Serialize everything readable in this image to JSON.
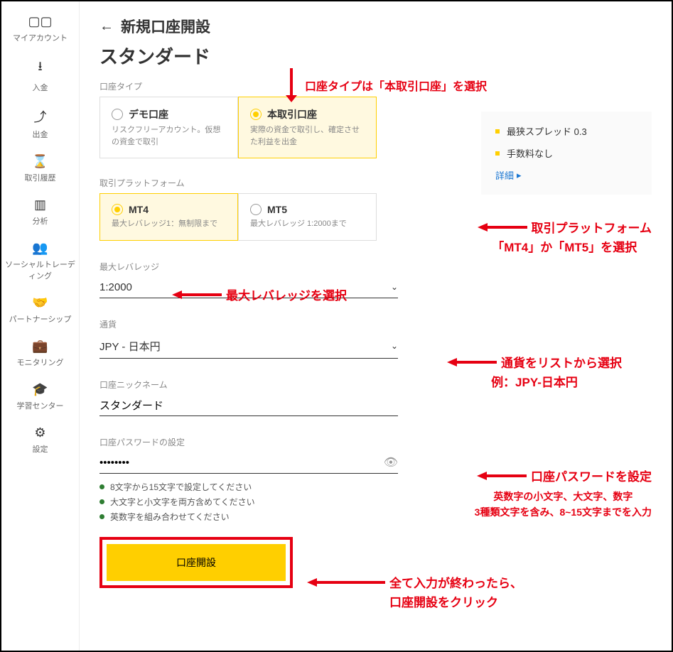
{
  "sidebar": {
    "items": [
      {
        "label": "マイアカウント"
      },
      {
        "label": "入金"
      },
      {
        "label": "出金"
      },
      {
        "label": "取引履歴"
      },
      {
        "label": "分析"
      },
      {
        "label": "ソーシャルトレーディング"
      },
      {
        "label": "パートナーシップ"
      },
      {
        "label": "モニタリング"
      },
      {
        "label": "学習センター"
      },
      {
        "label": "設定"
      }
    ]
  },
  "header": {
    "back_title": "新規口座開設",
    "subtitle": "スタンダード"
  },
  "account_type": {
    "label": "口座タイプ",
    "options": [
      {
        "title": "デモ口座",
        "desc": "リスクフリーアカウント。仮想の資金で取引"
      },
      {
        "title": "本取引口座",
        "desc": "実際の資金で取引し、確定させた利益を出金"
      }
    ]
  },
  "info": {
    "items": [
      "最狭スプレッド 0.3",
      "手数料なし"
    ],
    "link": "詳細"
  },
  "platform": {
    "label": "取引プラットフォーム",
    "options": [
      {
        "title": "MT4",
        "desc": "最大レバレッジ1：無制限まで"
      },
      {
        "title": "MT5",
        "desc": "最大レバレッジ 1:2000まで"
      }
    ]
  },
  "leverage": {
    "label": "最大レバレッジ",
    "value": "1:2000"
  },
  "currency": {
    "label": "通貨",
    "value": "JPY - 日本円"
  },
  "nickname": {
    "label": "口座ニックネーム",
    "value": "スタンダード"
  },
  "password": {
    "label": "口座パスワードの設定",
    "value": "••••••••",
    "rules": [
      "8文字から15文字で設定してください",
      "大文字と小文字を両方含めてください",
      "英数字を組み合わせてください"
    ]
  },
  "submit": {
    "label": "口座開設"
  },
  "annotations": {
    "a1": "口座タイプは「本取引口座」を選択",
    "a2_l1": "取引プラットフォーム",
    "a2_l2": "「MT4」か「MT5」を選択",
    "a3": "最大レバレッジを選択",
    "a4_l1": "通貨をリストから選択",
    "a4_l2": "例：JPY-日本円",
    "a5_l1": "口座パスワードを設定",
    "a5_l2": "英数字の小文字、大文字、数字",
    "a5_l3": "3種類文字を含み、8~15文字までを入力",
    "a6_l1": "全て入力が終わったら、",
    "a6_l2": "口座開設をクリック"
  }
}
